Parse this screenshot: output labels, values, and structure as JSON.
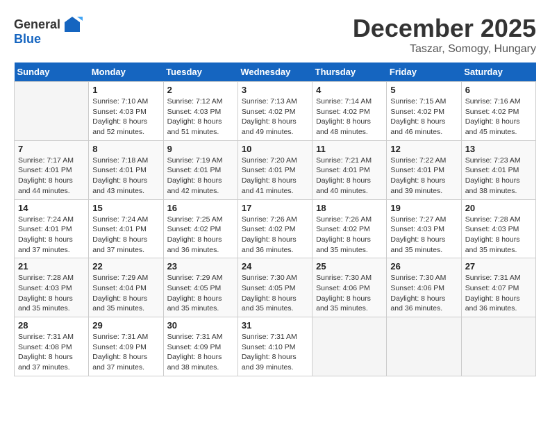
{
  "header": {
    "logo_general": "General",
    "logo_blue": "Blue",
    "month": "December 2025",
    "location": "Taszar, Somogy, Hungary"
  },
  "weekdays": [
    "Sunday",
    "Monday",
    "Tuesday",
    "Wednesday",
    "Thursday",
    "Friday",
    "Saturday"
  ],
  "weeks": [
    [
      {
        "day": "",
        "info": ""
      },
      {
        "day": "1",
        "info": "Sunrise: 7:10 AM\nSunset: 4:03 PM\nDaylight: 8 hours\nand 52 minutes."
      },
      {
        "day": "2",
        "info": "Sunrise: 7:12 AM\nSunset: 4:03 PM\nDaylight: 8 hours\nand 51 minutes."
      },
      {
        "day": "3",
        "info": "Sunrise: 7:13 AM\nSunset: 4:02 PM\nDaylight: 8 hours\nand 49 minutes."
      },
      {
        "day": "4",
        "info": "Sunrise: 7:14 AM\nSunset: 4:02 PM\nDaylight: 8 hours\nand 48 minutes."
      },
      {
        "day": "5",
        "info": "Sunrise: 7:15 AM\nSunset: 4:02 PM\nDaylight: 8 hours\nand 46 minutes."
      },
      {
        "day": "6",
        "info": "Sunrise: 7:16 AM\nSunset: 4:02 PM\nDaylight: 8 hours\nand 45 minutes."
      }
    ],
    [
      {
        "day": "7",
        "info": "Sunrise: 7:17 AM\nSunset: 4:01 PM\nDaylight: 8 hours\nand 44 minutes."
      },
      {
        "day": "8",
        "info": "Sunrise: 7:18 AM\nSunset: 4:01 PM\nDaylight: 8 hours\nand 43 minutes."
      },
      {
        "day": "9",
        "info": "Sunrise: 7:19 AM\nSunset: 4:01 PM\nDaylight: 8 hours\nand 42 minutes."
      },
      {
        "day": "10",
        "info": "Sunrise: 7:20 AM\nSunset: 4:01 PM\nDaylight: 8 hours\nand 41 minutes."
      },
      {
        "day": "11",
        "info": "Sunrise: 7:21 AM\nSunset: 4:01 PM\nDaylight: 8 hours\nand 40 minutes."
      },
      {
        "day": "12",
        "info": "Sunrise: 7:22 AM\nSunset: 4:01 PM\nDaylight: 8 hours\nand 39 minutes."
      },
      {
        "day": "13",
        "info": "Sunrise: 7:23 AM\nSunset: 4:01 PM\nDaylight: 8 hours\nand 38 minutes."
      }
    ],
    [
      {
        "day": "14",
        "info": "Sunrise: 7:24 AM\nSunset: 4:01 PM\nDaylight: 8 hours\nand 37 minutes."
      },
      {
        "day": "15",
        "info": "Sunrise: 7:24 AM\nSunset: 4:01 PM\nDaylight: 8 hours\nand 37 minutes."
      },
      {
        "day": "16",
        "info": "Sunrise: 7:25 AM\nSunset: 4:02 PM\nDaylight: 8 hours\nand 36 minutes."
      },
      {
        "day": "17",
        "info": "Sunrise: 7:26 AM\nSunset: 4:02 PM\nDaylight: 8 hours\nand 36 minutes."
      },
      {
        "day": "18",
        "info": "Sunrise: 7:26 AM\nSunset: 4:02 PM\nDaylight: 8 hours\nand 35 minutes."
      },
      {
        "day": "19",
        "info": "Sunrise: 7:27 AM\nSunset: 4:03 PM\nDaylight: 8 hours\nand 35 minutes."
      },
      {
        "day": "20",
        "info": "Sunrise: 7:28 AM\nSunset: 4:03 PM\nDaylight: 8 hours\nand 35 minutes."
      }
    ],
    [
      {
        "day": "21",
        "info": "Sunrise: 7:28 AM\nSunset: 4:03 PM\nDaylight: 8 hours\nand 35 minutes."
      },
      {
        "day": "22",
        "info": "Sunrise: 7:29 AM\nSunset: 4:04 PM\nDaylight: 8 hours\nand 35 minutes."
      },
      {
        "day": "23",
        "info": "Sunrise: 7:29 AM\nSunset: 4:05 PM\nDaylight: 8 hours\nand 35 minutes."
      },
      {
        "day": "24",
        "info": "Sunrise: 7:30 AM\nSunset: 4:05 PM\nDaylight: 8 hours\nand 35 minutes."
      },
      {
        "day": "25",
        "info": "Sunrise: 7:30 AM\nSunset: 4:06 PM\nDaylight: 8 hours\nand 35 minutes."
      },
      {
        "day": "26",
        "info": "Sunrise: 7:30 AM\nSunset: 4:06 PM\nDaylight: 8 hours\nand 36 minutes."
      },
      {
        "day": "27",
        "info": "Sunrise: 7:31 AM\nSunset: 4:07 PM\nDaylight: 8 hours\nand 36 minutes."
      }
    ],
    [
      {
        "day": "28",
        "info": "Sunrise: 7:31 AM\nSunset: 4:08 PM\nDaylight: 8 hours\nand 37 minutes."
      },
      {
        "day": "29",
        "info": "Sunrise: 7:31 AM\nSunset: 4:09 PM\nDaylight: 8 hours\nand 37 minutes."
      },
      {
        "day": "30",
        "info": "Sunrise: 7:31 AM\nSunset: 4:09 PM\nDaylight: 8 hours\nand 38 minutes."
      },
      {
        "day": "31",
        "info": "Sunrise: 7:31 AM\nSunset: 4:10 PM\nDaylight: 8 hours\nand 39 minutes."
      },
      {
        "day": "",
        "info": ""
      },
      {
        "day": "",
        "info": ""
      },
      {
        "day": "",
        "info": ""
      }
    ]
  ]
}
